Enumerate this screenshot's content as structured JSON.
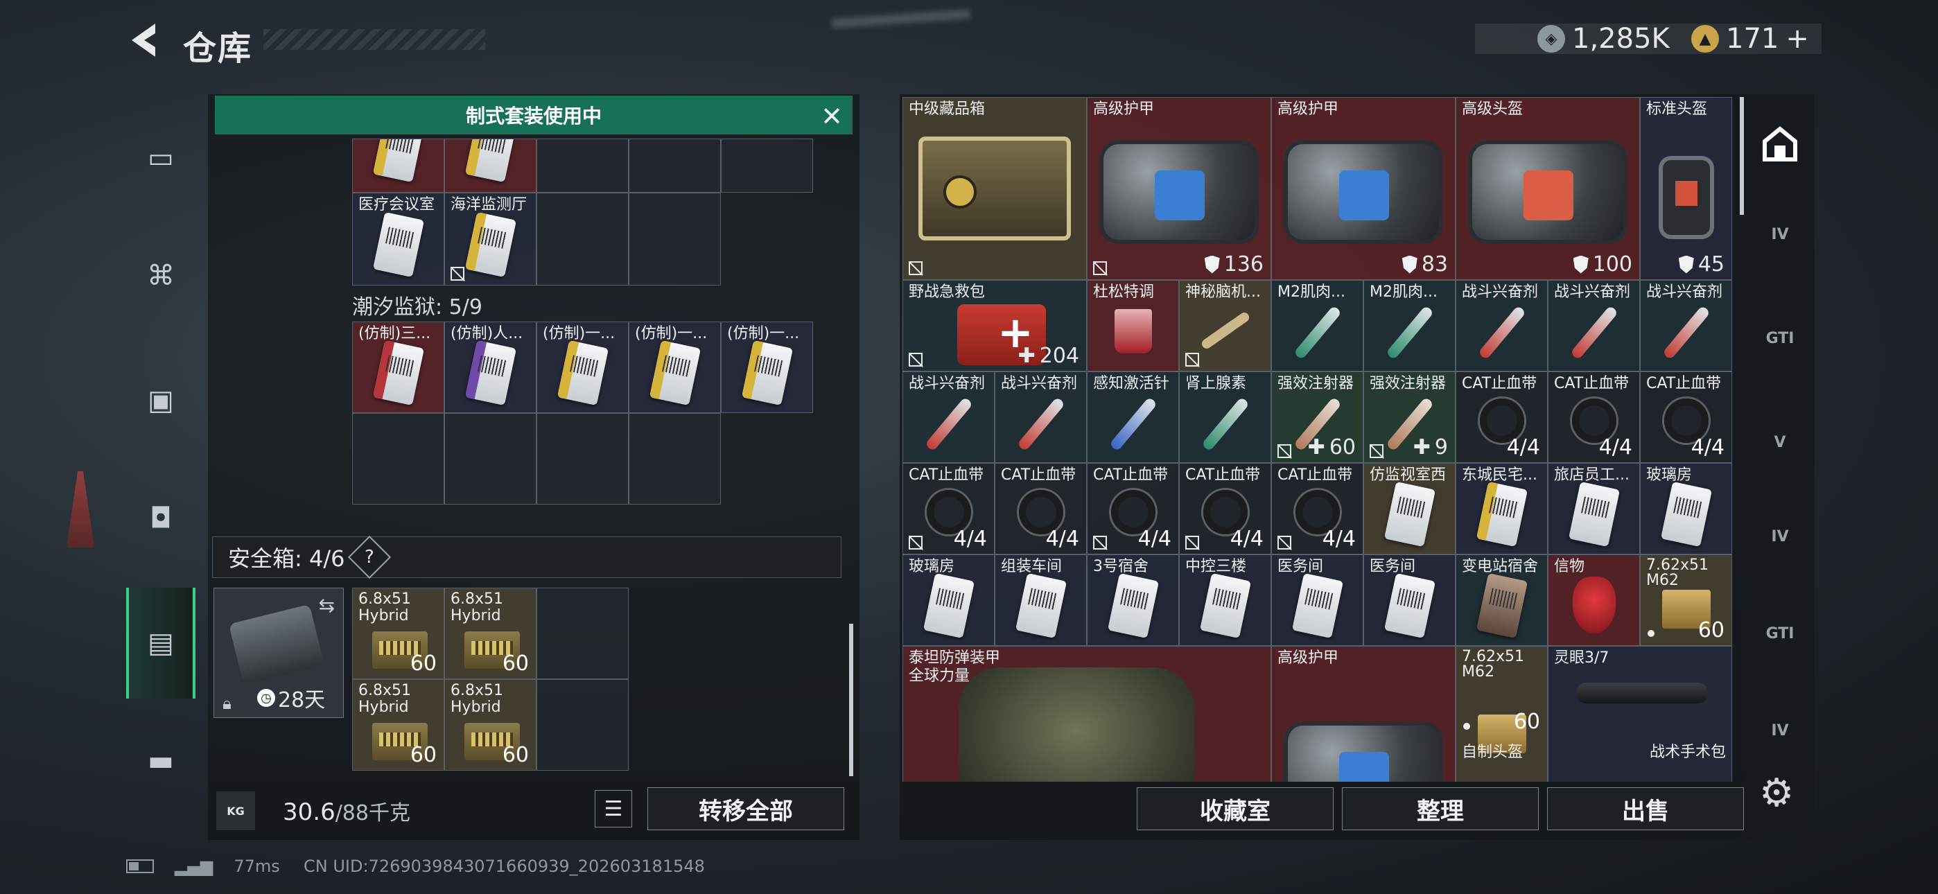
{
  "header": {
    "title": "仓库",
    "currency_1": "1,285K",
    "currency_2": "171",
    "currency_2_plus": "+"
  },
  "nav_icons": [
    "pistol-icon",
    "vest-icon",
    "backpack-icon",
    "bag-icon",
    "stash-icon",
    "briefcase-icon"
  ],
  "banner": {
    "text": "制式套装使用中"
  },
  "left_stash": {
    "row1_cards": [
      {
        "name": "医疗会议室"
      },
      {
        "name": "海洋监测厅"
      }
    ],
    "section_label": "潮汐监狱: 5/9",
    "prison_cards": [
      {
        "name": "(仿制)三..."
      },
      {
        "name": "(仿制)人..."
      },
      {
        "name": "(仿制)一..."
      },
      {
        "name": "(仿制)一..."
      },
      {
        "name": "(仿制)一..."
      }
    ]
  },
  "safebox": {
    "label": "安全箱: 4/6",
    "help": "?",
    "days": "28天",
    "ammo": [
      {
        "name": "6.8x51\nHybrid",
        "count": "60"
      },
      {
        "name": "6.8x51\nHybrid",
        "count": "60"
      },
      {
        "name": "6.8x51\nHybrid",
        "count": "60"
      },
      {
        "name": "6.8x51\nHybrid",
        "count": "60"
      }
    ]
  },
  "footer_left": {
    "kg_icon": "KG",
    "weight": "30.6",
    "capacity": "/88千克",
    "transfer_all": "转移全部"
  },
  "right_grid": {
    "row1": [
      {
        "name": "中级藏品箱"
      },
      {
        "name": "高级护甲",
        "value": "136"
      },
      {
        "name": "高级护甲",
        "value": "83"
      },
      {
        "name": "高级头盔",
        "value": "100"
      },
      {
        "name": "标准头盔",
        "value": "45"
      }
    ],
    "row2": [
      {
        "name": "野战急救包",
        "value": "204"
      },
      {
        "name": "杜松特调"
      },
      {
        "name": "神秘脑机..."
      },
      {
        "name": "M2肌肉..."
      },
      {
        "name": "M2肌肉..."
      },
      {
        "name": "战斗兴奋剂"
      },
      {
        "name": "战斗兴奋剂"
      },
      {
        "name": "战斗兴奋剂"
      }
    ],
    "row3": [
      {
        "name": "战斗兴奋剂"
      },
      {
        "name": "战斗兴奋剂"
      },
      {
        "name": "感知激活针"
      },
      {
        "name": "肾上腺素"
      },
      {
        "name": "强效注射器",
        "value": "60"
      },
      {
        "name": "强效注射器",
        "value": "9"
      },
      {
        "name": "CAT止血带",
        "value": "4/4"
      },
      {
        "name": "CAT止血带",
        "value": "4/4"
      },
      {
        "name": "CAT止血带",
        "value": "4/4"
      }
    ],
    "row4": [
      {
        "name": "CAT止血带",
        "value": "4/4"
      },
      {
        "name": "CAT止血带",
        "value": "4/4"
      },
      {
        "name": "CAT止血带",
        "value": "4/4"
      },
      {
        "name": "CAT止血带",
        "value": "4/4"
      },
      {
        "name": "CAT止血带",
        "value": "4/4"
      },
      {
        "name": "仿监视室西"
      },
      {
        "name": "东城民宅..."
      },
      {
        "name": "旅店员工..."
      },
      {
        "name": "玻璃房"
      }
    ],
    "row5": [
      {
        "name": "玻璃房"
      },
      {
        "name": "组装车间"
      },
      {
        "name": "3号宿舍"
      },
      {
        "name": "中控三楼"
      },
      {
        "name": "医务间"
      },
      {
        "name": "医务间"
      },
      {
        "name": "变电站宿舍"
      },
      {
        "name": "信物"
      },
      {
        "name": "7.62x51\nM62",
        "value": "60"
      }
    ],
    "row6": [
      {
        "name": "泰坦防弹装甲\n全球力量"
      },
      {
        "name": "高级护甲"
      },
      {
        "name": "7.62x51\nM62",
        "value": "60"
      },
      {
        "name": "灵眼3/7"
      },
      {
        "name": "自制头盔"
      },
      {
        "name": "战术手术包"
      }
    ]
  },
  "footer_right": {
    "collection": "收藏室",
    "sort": "整理",
    "sell": "出售"
  },
  "right_sidebar": [
    "IV",
    "GTI",
    "V",
    "IV",
    "GTI",
    "IV"
  ],
  "status": {
    "ping": "77ms",
    "uid": "CN UID:7269039843071660939_202603181548"
  }
}
